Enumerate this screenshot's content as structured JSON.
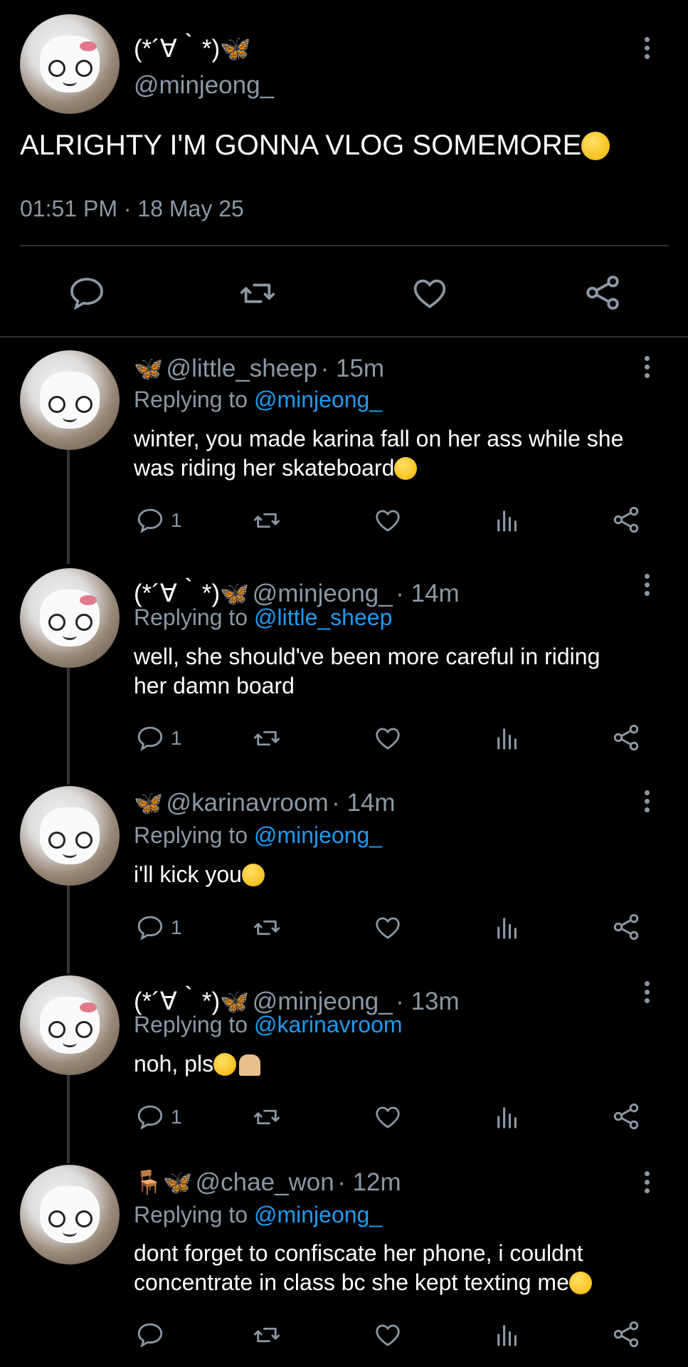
{
  "main_tweet": {
    "display_name": "(*´∀｀*)",
    "handle": "@minjeong_",
    "text": "ALRIGHTY I'M GONNA VLOG SOMEMORE",
    "timestamp": "01:51 PM · 18 May 25"
  },
  "replies": [
    {
      "display_name": "",
      "handle": "@little_sheep",
      "time": "· 15m",
      "replying_label": "Replying to",
      "replying_to": "@minjeong_",
      "text_line1": "winter, you made karina fall on her ass while she",
      "text_line2": "was riding her skateboard",
      "reply_count": "1"
    },
    {
      "display_name": "(*´∀｀*)",
      "handle": "@minjeong_",
      "time": "· 14m",
      "replying_label": "Replying to",
      "replying_to": "@little_sheep",
      "text_line1": "well, she should've been more careful in riding",
      "text_line2": "her damn board",
      "reply_count": "1"
    },
    {
      "display_name": "",
      "handle": "@karinavroom",
      "time": "· 14m",
      "replying_label": "Replying to",
      "replying_to": "@minjeong_",
      "text_line1": "i'll kick you",
      "text_line2": "",
      "reply_count": "1"
    },
    {
      "display_name": "(*´∀｀*)",
      "handle": "@minjeong_",
      "time": "· 13m",
      "replying_label": "Replying to",
      "replying_to": "@karinavroom",
      "text_line1": "noh, pls",
      "text_line2": "",
      "reply_count": "1"
    },
    {
      "display_name": "",
      "handle": "@chae_won",
      "time": "· 12m",
      "replying_label": "Replying to",
      "replying_to": "@minjeong_",
      "text_line1": "dont forget to confiscate her phone, i couldnt",
      "text_line2": "concentrate in class bc she kept texting me",
      "reply_count": ""
    }
  ],
  "icons": {
    "reply": "reply-icon",
    "retweet": "retweet-icon",
    "like": "heart-icon",
    "views": "views-icon",
    "share": "share-icon",
    "more": "more-vertical-icon",
    "butterfly": "butterfly-emoji",
    "chair": "chair-emoji"
  },
  "colors": {
    "background": "#000000",
    "text": "#ffffff",
    "secondary": "#8b98a5",
    "mention": "#1d9bf0",
    "divider": "#2f3336"
  }
}
